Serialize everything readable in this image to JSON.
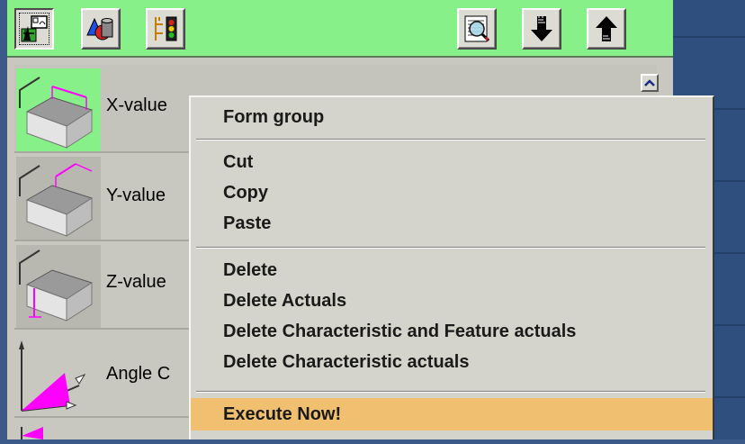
{
  "toolbar": {
    "buttons": [
      {
        "icon": "measure-setup-icon",
        "pressed": true
      },
      {
        "icon": "shapes-icon"
      },
      {
        "icon": "tree-signal-icon"
      },
      {
        "icon": "search-document-icon"
      },
      {
        "icon": "arrow-down-icon"
      },
      {
        "icon": "arrow-up-icon"
      }
    ]
  },
  "list": {
    "rows": [
      {
        "label": "X-value",
        "icon": "x-value-block-icon"
      },
      {
        "label": "Y-value",
        "icon": "y-value-block-icon"
      },
      {
        "label": "Z-value",
        "icon": "z-value-block-icon"
      },
      {
        "label": "Angle C",
        "icon": "angle-axes-icon"
      }
    ]
  },
  "context_menu": {
    "items": [
      {
        "label": "Form group"
      },
      {
        "label": "Cut"
      },
      {
        "label": "Copy"
      },
      {
        "label": "Paste"
      },
      {
        "label": "Delete"
      },
      {
        "label": "Delete Actuals"
      },
      {
        "label": "Delete Characteristic and Feature actuals"
      },
      {
        "label": "Delete Characteristic actuals"
      },
      {
        "label": "Execute Now!",
        "highlighted": true
      }
    ]
  },
  "colors": {
    "toolbar_bg": "#88f088",
    "selected_thumb_bg": "#88f088",
    "menu_bg": "#d4d4cc",
    "menu_highlight": "#f0c070",
    "magenta_accent": "#ff00ff"
  }
}
